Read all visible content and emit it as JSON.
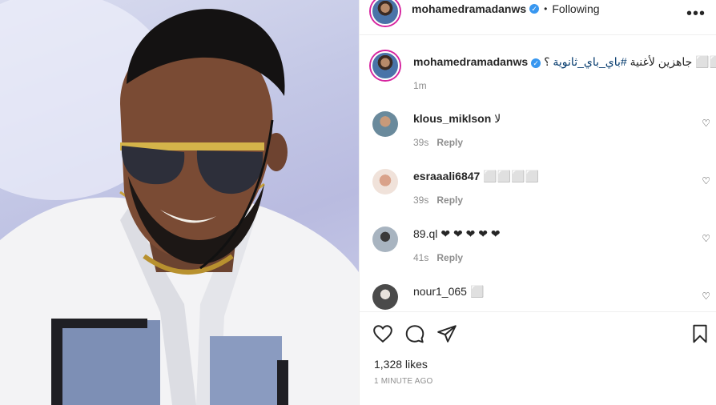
{
  "post": {
    "username": "mohamedramadanws",
    "verified_mark": "✓",
    "separator": "•",
    "follow_status": "Following",
    "more_icon": "•••"
  },
  "caption": {
    "username": "mohamedramadanws",
    "text_before": "جاهزين لأغنية ",
    "hashtag": "#باي_باي_ثانوية",
    "text_after": " ؟ ⬜⬜",
    "time": "1m"
  },
  "comments": [
    {
      "username": "klous_miklson",
      "text": "لا",
      "time": "39s",
      "reply": "Reply"
    },
    {
      "username": "esraaali6847",
      "text": "⬜⬜⬜⬜",
      "time": "39s",
      "reply": "Reply"
    },
    {
      "username": "89.ql",
      "text": "❤ ❤ ❤ ❤ ❤",
      "time": "41s",
      "reply": "Reply"
    },
    {
      "username": "nour1_065",
      "text": "⬜",
      "time": "",
      "reply": ""
    }
  ],
  "footer": {
    "likes": "1,328 likes",
    "time_ago": "1 MINUTE AGO"
  },
  "icons": {
    "like": "heart-outline-icon",
    "comment": "comment-bubble-icon",
    "share": "paper-plane-icon",
    "save": "bookmark-icon",
    "comment_like": "small-heart-icon"
  },
  "colors": {
    "text": "#262626",
    "muted": "#8e8e8e",
    "hashtag": "#00376b",
    "verified": "#3897f0",
    "border": "#efefef"
  }
}
